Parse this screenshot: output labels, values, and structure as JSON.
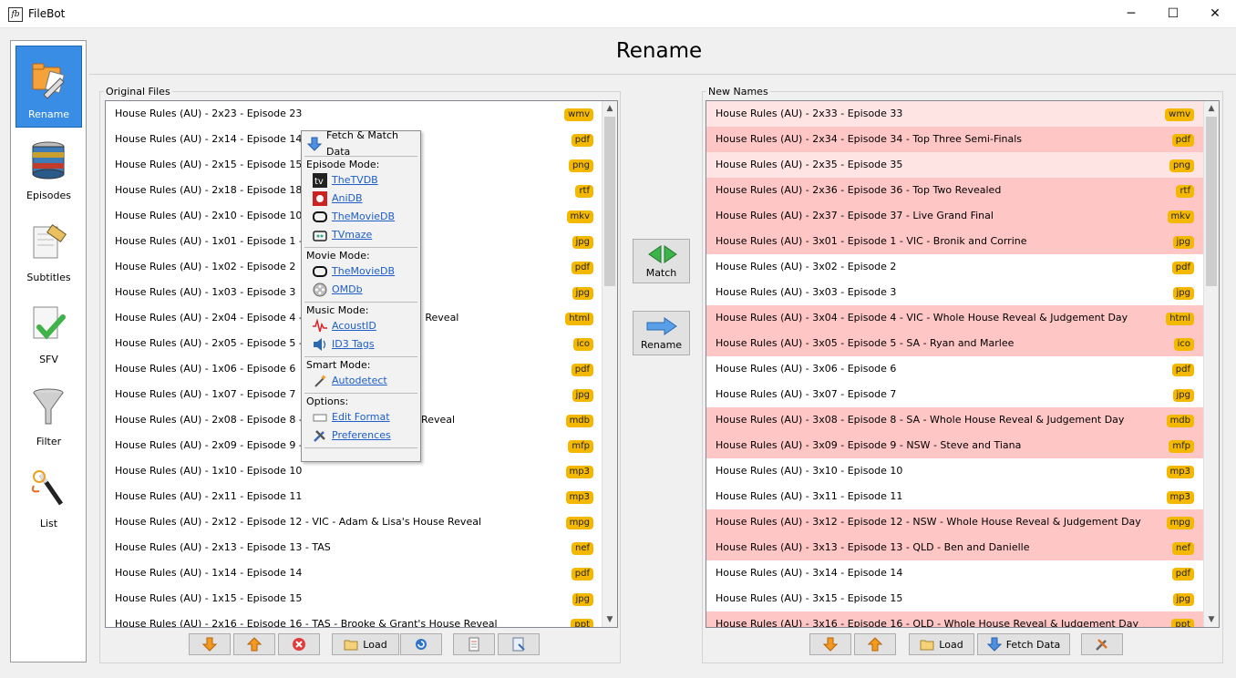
{
  "window": {
    "title": "FileBot",
    "icon_text": "fb",
    "minimize": "─",
    "maximize": "☐",
    "close": "✕"
  },
  "page_title": "Rename",
  "sidebar": {
    "items": [
      {
        "label": "Rename",
        "icon": "rename-icon"
      },
      {
        "label": "Episodes",
        "icon": "episodes-icon"
      },
      {
        "label": "Subtitles",
        "icon": "subtitles-icon"
      },
      {
        "label": "SFV",
        "icon": "sfv-icon"
      },
      {
        "label": "Filter",
        "icon": "filter-icon"
      },
      {
        "label": "List",
        "icon": "list-icon"
      }
    ]
  },
  "original": {
    "label": "Original Files",
    "rows": [
      {
        "name": "House Rules (AU) - 2x23 - Episode 23",
        "ext": "wmv"
      },
      {
        "name": "House Rules (AU) - 2x14 - Episode 14",
        "ext": "pdf"
      },
      {
        "name": "House Rules (AU) - 2x15 - Episode 15",
        "ext": "png"
      },
      {
        "name": "House Rules (AU) - 2x18 - Episode 18",
        "ext": "rtf"
      },
      {
        "name": "House Rules (AU) - 2x10 - Episode 10",
        "ext": "mkv"
      },
      {
        "name": "House Rules (AU) - 1x01 - Episode 1 - WA T",
        "ext": "jpg"
      },
      {
        "name": "House Rules (AU) - 1x02 - Episode 2",
        "ext": "pdf"
      },
      {
        "name": "House Rules (AU) - 1x03 - Episode 3",
        "ext": "jpg"
      },
      {
        "name": "House Rules (AU) - 2x04 - Episode 4 - NSW                              Reveal",
        "ext": "html"
      },
      {
        "name": "House Rules (AU) - 2x05 - Episode 5 - WA",
        "ext": "ico"
      },
      {
        "name": "House Rules (AU) - 1x06 - Episode 6",
        "ext": "pdf"
      },
      {
        "name": "House Rules (AU) - 1x07 - Episode 7",
        "ext": "jpg"
      },
      {
        "name": "House Rules (AU) - 2x08 - Episode 8 - WA -                             Reveal",
        "ext": "mdb"
      },
      {
        "name": "House Rules (AU) - 2x09 - Episode 9 - VIC",
        "ext": "mfp"
      },
      {
        "name": "House Rules (AU) - 1x10 - Episode 10",
        "ext": "mp3"
      },
      {
        "name": "House Rules (AU) - 2x11 - Episode 11",
        "ext": "mp3"
      },
      {
        "name": "House Rules (AU) - 2x12 - Episode 12 - VIC - Adam & Lisa's House Reveal",
        "ext": "mpg"
      },
      {
        "name": "House Rules (AU) - 2x13 - Episode 13 - TAS",
        "ext": "nef"
      },
      {
        "name": "House Rules (AU) - 1x14 - Episode 14",
        "ext": "pdf"
      },
      {
        "name": "House Rules (AU) - 1x15 - Episode 15",
        "ext": "jpg"
      },
      {
        "name": "House Rules (AU) - 2x16 - Episode 16 - TAS - Brooke & Grant's House Reveal",
        "ext": "ppt"
      }
    ],
    "buttons": {
      "load": "Load"
    }
  },
  "new_names": {
    "label": "New Names",
    "rows": [
      {
        "name": "House Rules (AU) - 2x33 - Episode 33",
        "ext": "wmv",
        "state": "light"
      },
      {
        "name": "House Rules (AU) - 2x34 - Episode 34 - Top Three Semi-Finals",
        "ext": "pdf",
        "state": "pink"
      },
      {
        "name": "House Rules (AU) - 2x35 - Episode 35",
        "ext": "png",
        "state": "light"
      },
      {
        "name": "House Rules (AU) - 2x36 - Episode 36 - Top Two Revealed",
        "ext": "rtf",
        "state": "pink"
      },
      {
        "name": "House Rules (AU) - 2x37 - Episode 37 - Live Grand Final",
        "ext": "mkv",
        "state": "pink"
      },
      {
        "name": "House Rules (AU) - 3x01 - Episode 1 - VIC - Bronik and Corrine",
        "ext": "jpg",
        "state": "pink"
      },
      {
        "name": "House Rules (AU) - 3x02 - Episode 2",
        "ext": "pdf",
        "state": "white"
      },
      {
        "name": "House Rules (AU) - 3x03 - Episode 3",
        "ext": "jpg",
        "state": "white"
      },
      {
        "name": "House Rules (AU) - 3x04 - Episode 4 - VIC - Whole House Reveal & Judgement Day",
        "ext": "html",
        "state": "pink"
      },
      {
        "name": "House Rules (AU) - 3x05 - Episode 5 - SA - Ryan and Marlee",
        "ext": "ico",
        "state": "pink"
      },
      {
        "name": "House Rules (AU) - 3x06 - Episode 6",
        "ext": "pdf",
        "state": "white"
      },
      {
        "name": "House Rules (AU) - 3x07 - Episode 7",
        "ext": "jpg",
        "state": "white"
      },
      {
        "name": "House Rules (AU) - 3x08 - Episode 8 - SA - Whole House Reveal & Judgement Day",
        "ext": "mdb",
        "state": "pink"
      },
      {
        "name": "House Rules (AU) - 3x09 - Episode 9 - NSW - Steve and Tiana",
        "ext": "mfp",
        "state": "pink"
      },
      {
        "name": "House Rules (AU) - 3x10 - Episode 10",
        "ext": "mp3",
        "state": "white"
      },
      {
        "name": "House Rules (AU) - 3x11 - Episode 11",
        "ext": "mp3",
        "state": "white"
      },
      {
        "name": "House Rules (AU) - 3x12 - Episode 12 - NSW - Whole House Reveal & Judgement Day",
        "ext": "mpg",
        "state": "pink"
      },
      {
        "name": "House Rules (AU) - 3x13 - Episode 13 - QLD - Ben and Danielle",
        "ext": "nef",
        "state": "pink"
      },
      {
        "name": "House Rules (AU) - 3x14 - Episode 14",
        "ext": "pdf",
        "state": "white"
      },
      {
        "name": "House Rules (AU) - 3x15 - Episode 15",
        "ext": "jpg",
        "state": "white"
      },
      {
        "name": "House Rules (AU) - 3x16 - Episode 16 - QLD - Whole House Reveal & Judgement Day",
        "ext": "ppt",
        "state": "pink"
      }
    ],
    "buttons": {
      "load": "Load",
      "fetch": "Fetch Data"
    }
  },
  "center": {
    "match": "Match",
    "rename": "Rename"
  },
  "popup": {
    "title": "Fetch & Match Data",
    "episode_header": "Episode Mode:",
    "episode_items": [
      "TheTVDB",
      "AniDB",
      "TheMovieDB",
      "TVmaze"
    ],
    "movie_header": "Movie Mode:",
    "movie_items": [
      "TheMovieDB",
      "OMDb"
    ],
    "music_header": "Music Mode:",
    "music_items": [
      "AcoustID",
      "ID3 Tags"
    ],
    "smart_header": "Smart Mode:",
    "smart_items": [
      "Autodetect"
    ],
    "options_header": "Options:",
    "options_items": [
      "Edit Format",
      "Preferences"
    ]
  },
  "colors": {
    "ext_badge": "#f5b800",
    "row_pink": "#ffc6c6",
    "row_light": "#ffe4e4",
    "active_blue": "#3a8de4"
  }
}
